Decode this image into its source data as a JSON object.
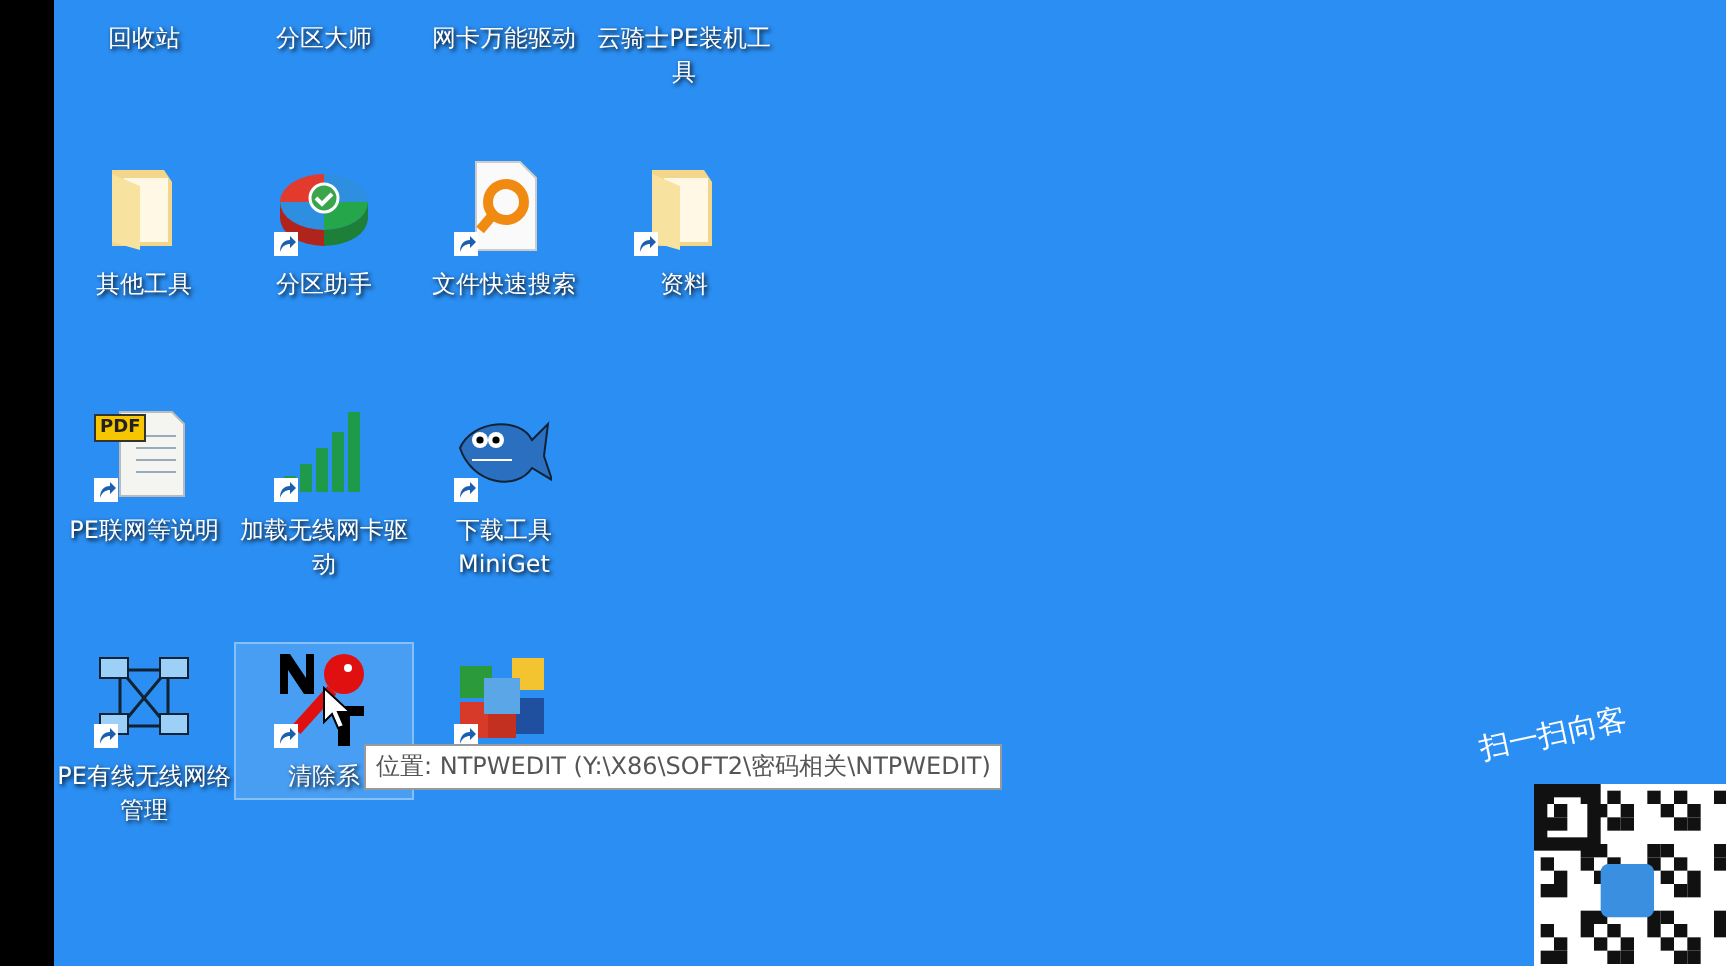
{
  "rows": [
    [
      {
        "label": "回收站",
        "shortcut": false,
        "selected": false
      },
      {
        "label": "分区大师",
        "shortcut": false,
        "selected": false
      },
      {
        "label": "网卡万能驱动",
        "shortcut": false,
        "selected": false
      },
      {
        "label": "云骑士PE装机工具",
        "shortcut": false,
        "selected": false
      }
    ],
    [
      {
        "label": "其他工具",
        "kind": "folder",
        "shortcut": false,
        "selected": false
      },
      {
        "label": "分区助手",
        "kind": "disk",
        "shortcut": true,
        "selected": false
      },
      {
        "label": "文件快速搜索",
        "kind": "search",
        "shortcut": true,
        "selected": false
      },
      {
        "label": "资料",
        "kind": "folder",
        "shortcut": true,
        "selected": false
      }
    ],
    [
      {
        "label": "PE联网等说明",
        "kind": "pdf",
        "badge": "PDF",
        "shortcut": true,
        "selected": false
      },
      {
        "label": "加载无线网卡驱动",
        "kind": "signal",
        "shortcut": true,
        "selected": false
      },
      {
        "label": "下载工具MiniGet",
        "kind": "fish",
        "shortcut": true,
        "selected": false
      }
    ],
    [
      {
        "label": "PE有线无线网络管理",
        "kind": "network",
        "shortcut": true,
        "selected": false
      },
      {
        "label": "清除系",
        "kind": "key",
        "shortcut": true,
        "selected": true
      },
      {
        "kind": "cubes",
        "shortcut": true,
        "selected": false
      }
    ]
  ],
  "tooltip": "位置: NTPWEDIT (Y:\\X86\\SOFT2\\密码相关\\NTPWEDIT)",
  "promo": {
    "caption": "扫一扫向客"
  }
}
